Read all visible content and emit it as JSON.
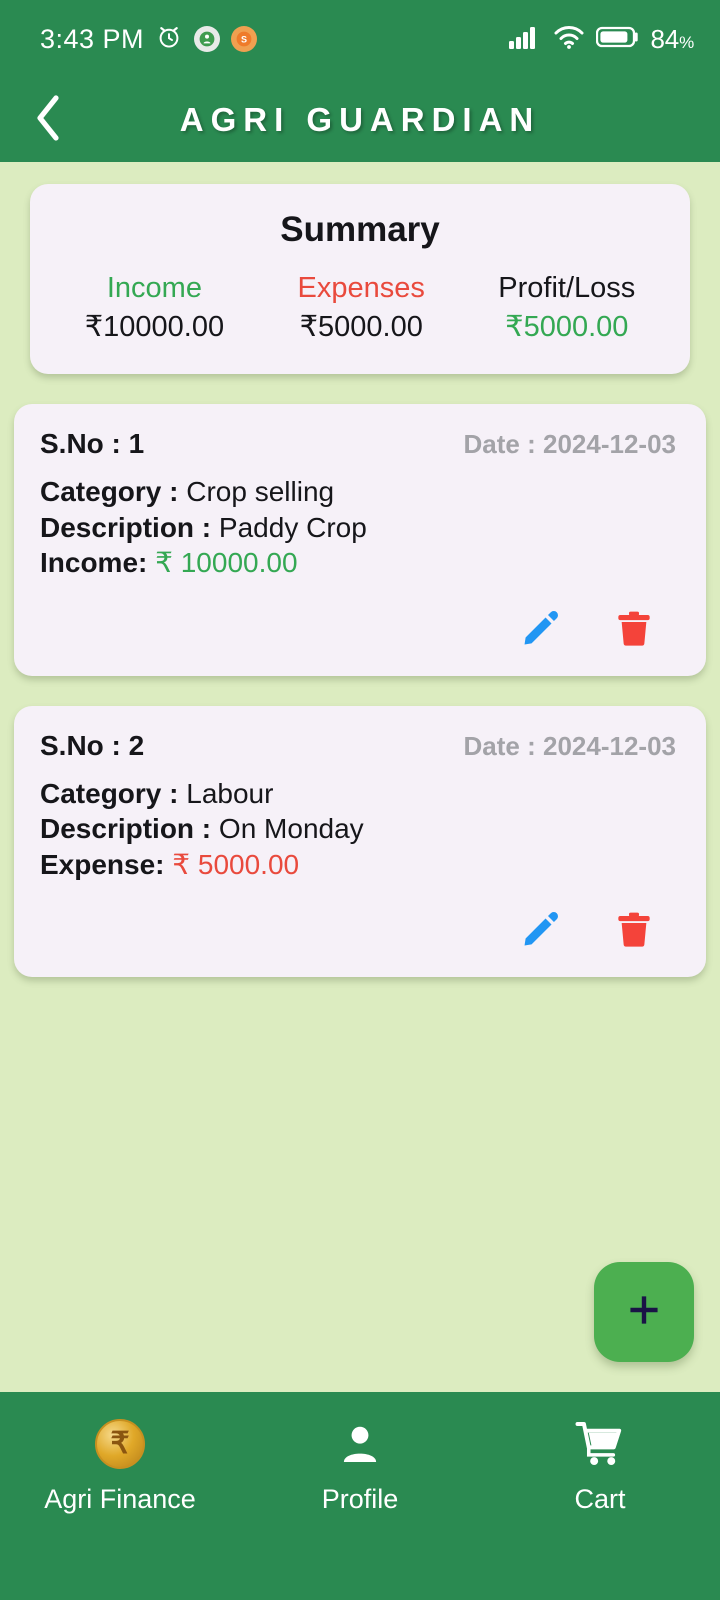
{
  "status_bar": {
    "time": "3:43 PM",
    "alarm_icon": "alarm-clock-icon",
    "notification_icons": [
      "app-notification-icon-1",
      "app-notification-icon-2"
    ],
    "signal_icon": "cellular-signal-icon",
    "wifi_icon": "wifi-icon",
    "battery_icon": "battery-icon",
    "battery_level": "84",
    "battery_unit": "%"
  },
  "header": {
    "back_icon": "chevron-left-icon",
    "title": "AGRI GUARDIAN"
  },
  "summary": {
    "title": "Summary",
    "items": [
      {
        "label": "Income",
        "value": "₹10000.00",
        "label_color": "#34a853",
        "value_color": "#16161a"
      },
      {
        "label": "Expenses",
        "value": "₹5000.00",
        "label_color": "#e94a3d",
        "value_color": "#16161a"
      },
      {
        "label": "Profit/Loss",
        "value": "₹5000.00",
        "label_color": "#16161a",
        "value_color": "#34a853"
      }
    ]
  },
  "transactions": [
    {
      "sno_label": "S.No : 1",
      "date_label": "Date : 2024-12-03",
      "category_label": "Category :",
      "category_value": "Crop selling",
      "description_label": "Description :",
      "description_value": "Paddy Crop",
      "amount_label": "Income:",
      "amount_value": "₹ 10000.00",
      "amount_color": "#34a853",
      "edit_icon": "edit-pencil-icon",
      "delete_icon": "delete-trash-icon"
    },
    {
      "sno_label": "S.No : 2",
      "date_label": "Date : 2024-12-03",
      "category_label": "Category :",
      "category_value": "Labour",
      "description_label": "Description :",
      "description_value": "On Monday",
      "amount_label": "Expense:",
      "amount_value": "₹ 5000.00",
      "amount_color": "#e94a3d",
      "edit_icon": "edit-pencil-icon",
      "delete_icon": "delete-trash-icon"
    }
  ],
  "fab": {
    "icon": "plus-icon",
    "label": "+"
  },
  "bottom_nav": {
    "items": [
      {
        "label": "Agri Finance",
        "icon": "rupee-coin-icon",
        "symbol": "₹"
      },
      {
        "label": "Profile",
        "icon": "person-icon",
        "symbol": ""
      },
      {
        "label": "Cart",
        "icon": "shopping-cart-icon",
        "symbol": ""
      }
    ]
  },
  "colors": {
    "brand_green": "#2a8a51",
    "page_background": "#dcecc0",
    "card_background": "#f6f1f8",
    "fab_green": "#4caf50",
    "income_green": "#34a853",
    "expense_red": "#e94a3d",
    "edit_blue": "#2196f3",
    "delete_red": "#f4433a",
    "date_gray": "#a3a3a8"
  }
}
